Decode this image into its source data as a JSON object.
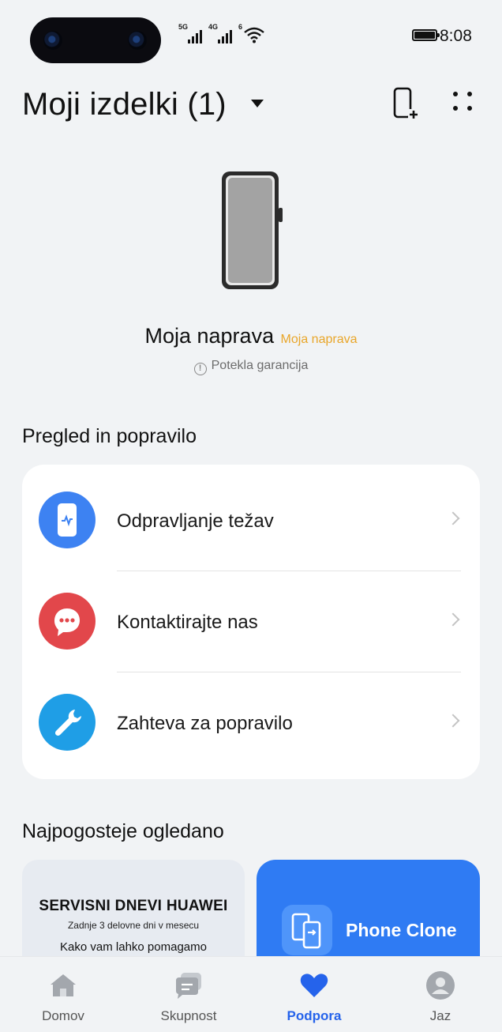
{
  "status_bar": {
    "time": "8:08",
    "sim1_tag": "5G",
    "sim2_tag": "4G",
    "wifi_tag": "6"
  },
  "header": {
    "title": "Moji izdelki (1)"
  },
  "device": {
    "name": "Moja naprava",
    "alias": "Moja naprava",
    "warranty_status": "Potekla garancija"
  },
  "sections": {
    "service_title": "Pregled in popravilo",
    "popular_title": "Najpogosteje ogledano"
  },
  "services": [
    {
      "label": "Odpravljanje težav",
      "icon": "phone-diagnostic-icon",
      "color": "#3d82f2"
    },
    {
      "label": "Kontaktirajte nas",
      "icon": "chat-bubble-icon",
      "color": "#e2474b"
    },
    {
      "label": "Zahteva za popravilo",
      "icon": "wrench-icon",
      "color": "#1f9ee6"
    }
  ],
  "promos": {
    "left": {
      "title": "SERVISNI DNEVI HUAWEI",
      "subtitle": "Zadnje 3 delovne dni v mesecu",
      "help": "Kako vam lahko pomagamo"
    },
    "right": {
      "label": "Phone Clone",
      "icon": "phone-clone-icon"
    }
  },
  "nav": [
    {
      "label": "Domov",
      "icon": "home-icon"
    },
    {
      "label": "Skupnost",
      "icon": "community-icon"
    },
    {
      "label": "Podpora",
      "icon": "heart-icon",
      "active": true
    },
    {
      "label": "Jaz",
      "icon": "profile-icon"
    }
  ],
  "colors": {
    "accent": "#2563eb",
    "alias": "#e9a62a",
    "background": "#f1f3f5"
  }
}
